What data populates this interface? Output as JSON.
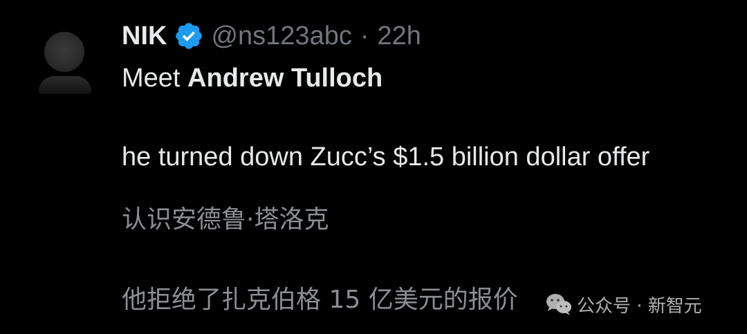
{
  "tweet": {
    "author_name": "NIK",
    "handle": "@ns123abc",
    "separator": "·",
    "time": "22h",
    "line1_prefix": "Meet ",
    "line1_bold": "Andrew Tulloch",
    "line2": "he turned down Zucc’s $1.5 billion dollar offer"
  },
  "translation": {
    "line1": "认识安德鲁·塔洛克",
    "line2": "他拒绝了扎克伯格 15 亿美元的报价"
  },
  "watermark": {
    "text": "公众号 · 新智元",
    "icon": "wechat-icon"
  },
  "icons": {
    "verified": "verified-badge-icon"
  },
  "colors": {
    "background": "#000000",
    "primary_text": "#e7e9ea",
    "secondary_text": "#71767b",
    "verified_blue": "#1d9bf0"
  }
}
